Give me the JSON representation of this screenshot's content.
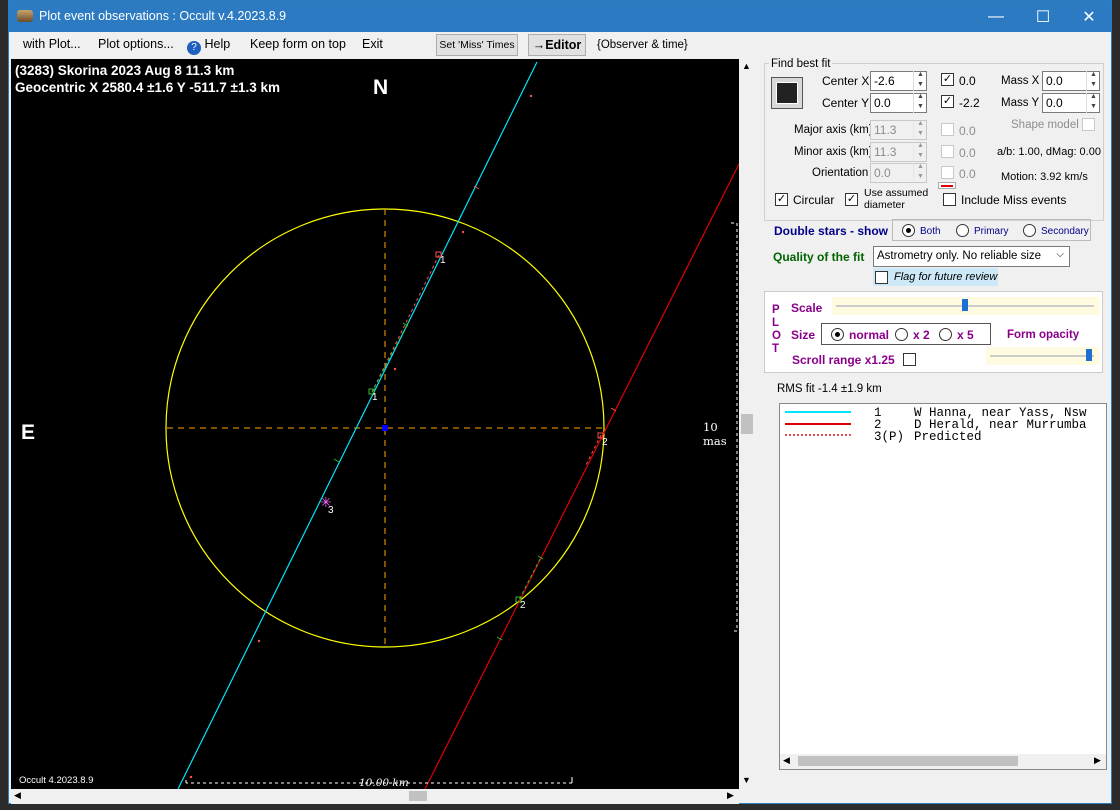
{
  "window": {
    "title": "Plot event observations : Occult v.4.2023.8.9",
    "minimize": "—",
    "maximize": "☐",
    "close": "✕"
  },
  "menu": {
    "with_plot": "with Plot...",
    "plot_options": "Plot options...",
    "help": "Help",
    "keep_on_top": "Keep form on top",
    "exit": "Exit",
    "set_miss_times": "Set 'Miss' Times",
    "editor": "→Editor",
    "observer_time": "{Observer & time}"
  },
  "plot": {
    "title_line1": "(3283) Skorina  2023 Aug 8   11.3 km",
    "title_line2": "Geocentric  X  2580.4 ±1.6  Y -511.7 ±1.3 km",
    "north": "N",
    "east": "E",
    "scale_mas": "10 mas",
    "scale_km": "10.00 km",
    "footer": "Occult 4.2023.8.9",
    "chord_labels": [
      "1",
      "1",
      "2",
      "2",
      "3"
    ]
  },
  "fit": {
    "group_title": "Find best fit",
    "center_x_label": "Center X",
    "center_x": "-2.6",
    "center_y_label": "Center Y",
    "center_y": "0.0",
    "chk_x_value": "0.0",
    "chk_y_value": "-2.2",
    "mass_x_label": "Mass X",
    "mass_x": "0.0",
    "mass_y_label": "Mass Y",
    "mass_y": "0.0",
    "major_label": "Major axis (km)",
    "major": "11.3",
    "major_chk": "0.0",
    "minor_label": "Minor axis (km)",
    "minor": "11.3",
    "minor_chk": "0.0",
    "orient_label": "Orientation",
    "orient": "0.0",
    "orient_chk": "0.0",
    "shape_model": "Shape model",
    "ab_dmag": "a/b: 1.00, dMag: 0.00",
    "motion": "Motion: 3.92 km/s",
    "circular": "Circular",
    "use_assumed": "Use assumed diameter",
    "include_miss": "Include Miss events"
  },
  "double_stars": {
    "label": "Double stars - show",
    "both": "Both",
    "primary": "Primary",
    "secondary": "Secondary"
  },
  "quality": {
    "label": "Quality of the fit",
    "value": "Astrometry only. No reliable size",
    "flag": "Flag for future review"
  },
  "plot_panel": {
    "vertical": [
      "P",
      "L",
      "O",
      "T"
    ],
    "scale": "Scale",
    "size": "Size",
    "normal": "normal",
    "x2": "x 2",
    "x5": "x 5",
    "form_opacity": "Form opacity",
    "scroll_range": "Scroll range x1.25"
  },
  "rms": "RMS fit -1.4 ±1.9 km",
  "legend": [
    {
      "num": "1",
      "text": "W Hanna, near Yass, Nsw",
      "color": "#00e5ff"
    },
    {
      "num": "2",
      "text": "D Herald, near Murrumba",
      "color": "#e00000"
    },
    {
      "num": "3(P)",
      "text": "Predicted",
      "color": "#e05050"
    }
  ]
}
